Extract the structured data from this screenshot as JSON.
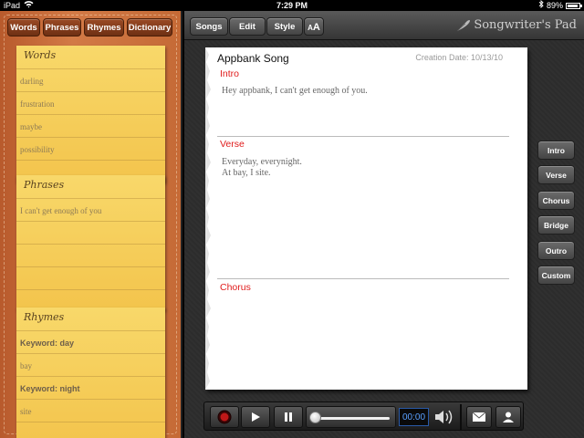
{
  "status_bar": {
    "device": "iPad",
    "time": "7:29 PM",
    "battery": "89%",
    "battery_level": 0.89
  },
  "left_tabs": [
    "Words",
    "Phrases",
    "Rhymes",
    "Dictionary"
  ],
  "words_note": {
    "title": "Words",
    "items": [
      "darling",
      "frustration",
      "maybe",
      "possibility"
    ]
  },
  "phrases_note": {
    "title": "Phrases",
    "items": [
      "I can't get enough of you"
    ]
  },
  "rhymes_note": {
    "title": "Rhymes",
    "items": [
      {
        "text": "Keyword: day",
        "keyword": true
      },
      {
        "text": "bay",
        "keyword": false
      },
      {
        "text": "Keyword: night",
        "keyword": true
      },
      {
        "text": "site",
        "keyword": false
      }
    ]
  },
  "toolbar": {
    "songs": "Songs",
    "edit": "Edit",
    "style": "Style",
    "font_small": "A",
    "font_large": "A"
  },
  "brand": {
    "name": "Songwriter's Pad"
  },
  "song": {
    "title": "Appbank Song",
    "creation_date": "Creation Date: 10/13/10",
    "sections": [
      {
        "label": "Intro",
        "lines": [
          "Hey appbank, I can't get enough of you."
        ]
      },
      {
        "label": "Verse",
        "lines": [
          "Everyday, everynight.",
          "At bay, I site."
        ]
      },
      {
        "label": "Chorus",
        "lines": []
      }
    ]
  },
  "side_buttons": [
    "Intro",
    "Verse",
    "Chorus",
    "Bridge",
    "Outro",
    "Custom"
  ],
  "player": {
    "time": "00:00",
    "progress": 0.0
  },
  "colors": {
    "section_label": "#e01b1b",
    "note_yellow": "#f5cd58",
    "leather": "#c56a36",
    "time_blue": "#5aa0ff"
  }
}
